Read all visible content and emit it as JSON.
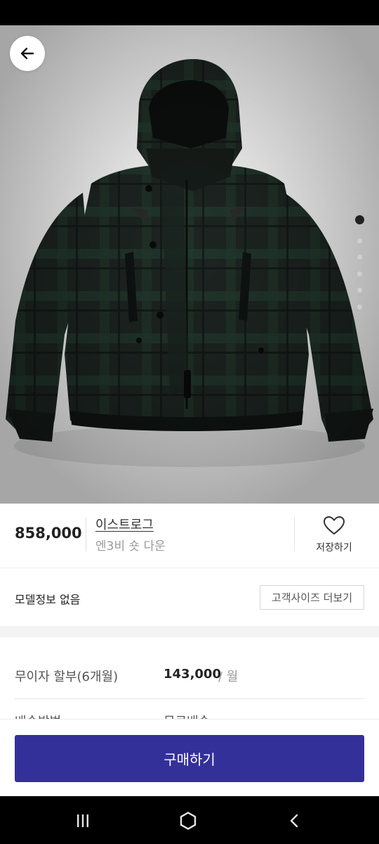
{
  "header": {
    "back_icon": "arrow-left-icon"
  },
  "gallery": {
    "image_alt": "dark green tartan down hooded jacket",
    "slide_count": 6,
    "active_slide": 1
  },
  "product": {
    "price": "858,000",
    "brand": "이스트로그",
    "name": "엔3비 숏 다운",
    "save_label": "저장하기",
    "save_icon": "heart-outline-icon"
  },
  "model": {
    "info_text": "모델정보 없음",
    "size_button_label": "고객사이즈 더보기"
  },
  "installment": {
    "label": "무이자 할부(6개월)",
    "amount": "143,000",
    "unit": "/ 월"
  },
  "partial_row": {
    "label": "배송방법",
    "value": "무료배송"
  },
  "footer": {
    "buy_label": "구매하기"
  },
  "nav": {
    "recent_icon": "recent-apps-icon",
    "home_icon": "home-icon",
    "back_icon": "back-chevron-icon"
  },
  "colors": {
    "accent": "#33309a",
    "jacket_dark": "#1f2a26",
    "jacket_green": "#24372d"
  }
}
